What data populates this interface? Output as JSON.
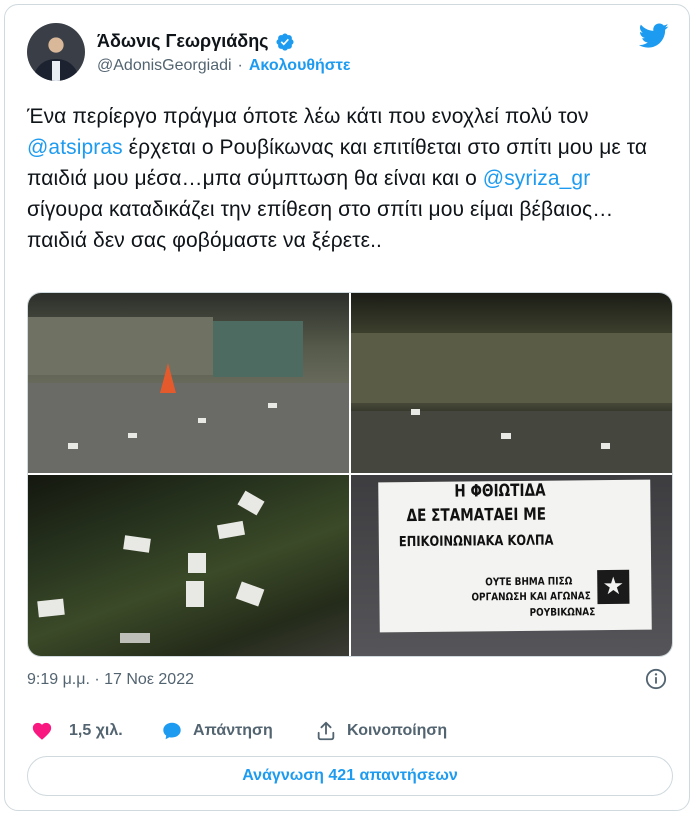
{
  "author": {
    "name": "Άδωνις Γεωργιάδης",
    "handle": "@AdonisGeorgiadi",
    "separator": "·",
    "follow_label": "Ακολουθήστε",
    "verified_icon": "verified-badge-icon"
  },
  "brand": {
    "icon": "twitter-bird-icon",
    "accent": "#1d9bf0"
  },
  "tweet": {
    "segments": {
      "t1": "Ένα περίεργο πράγμα όποτε λέω κάτι που ενοχλεί πολύ τον ",
      "m1": "@atsipras",
      "t2": " έρχεται ο Ρουβίκωνας και επιτίθεται στο σπίτι μου με τα παιδιά μου μέσα…μπα σύμπτωση θα είναι και ο ",
      "m2": "@syriza_gr",
      "t3": " σίγουρα καταδικάζει την επίθεση στο σπίτι μου είμαι βέβαιος…παιδιά δεν σας φοβόμαστε να ξέρετε.."
    }
  },
  "media": {
    "poster": {
      "line1": "Η ΦΘΙΩΤΙΔΑ",
      "line2": "ΔΕ ΣΤΑΜΑΤΑΕΙ ΜΕ",
      "line3": "ΕΠΙΚΟΙΝΩΝΙΑΚΑ ΚΟΛΠΑ",
      "line4": "ΟΥΤΕ ΒΗΜΑ ΠΙΣΩ",
      "line5": "ΟΡΓΑΝΩΣΗ ΚΑΙ ΑΓΩΝΑΣ",
      "line6": "ΡΟΥΒΙΚΩΝΑΣ",
      "star": "★"
    }
  },
  "meta": {
    "timestamp": "9:19 μ.μ. · 17 Νοε 2022",
    "info_icon": "info-icon"
  },
  "actions": {
    "likes": "1,5 χιλ.",
    "reply_label": "Απάντηση",
    "share_label": "Κοινοποίηση",
    "like_color": "#f91880"
  },
  "footer": {
    "read_replies": "Ανάγνωση 421 απαντήσεων"
  }
}
